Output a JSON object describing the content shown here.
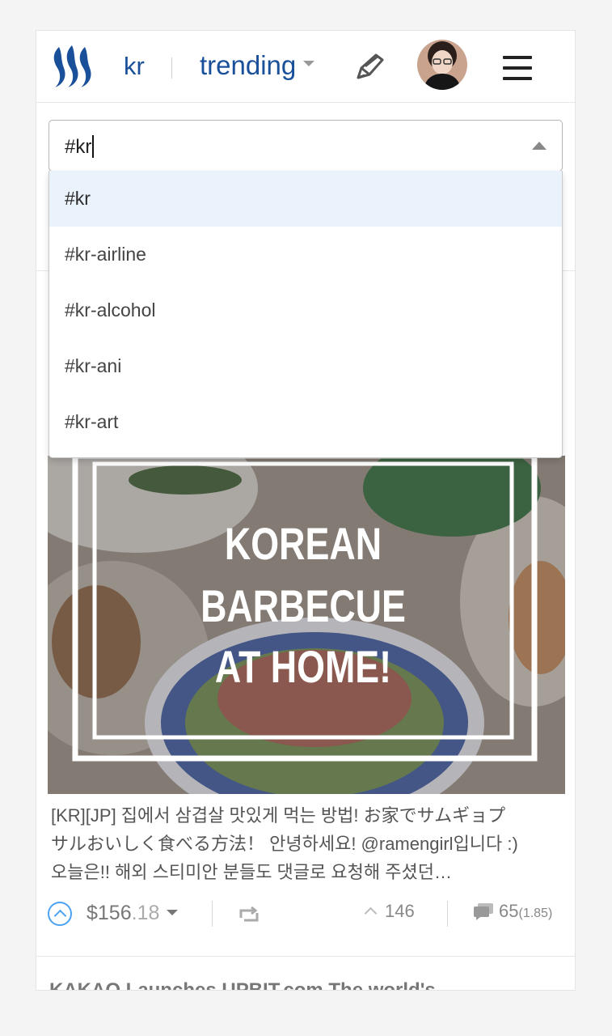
{
  "header": {
    "tag": "kr",
    "sort": "trending"
  },
  "search": {
    "value": "#kr",
    "options": [
      "#kr",
      "#kr-airline",
      "#kr-alcohol",
      "#kr-ani",
      "#kr-art"
    ]
  },
  "post": {
    "image_text": [
      "KOREAN",
      "BARBECUE",
      "AT HOME!"
    ],
    "excerpt_lines": [
      "[KR][JP] 집에서 삼겹살 맛있게 먹는 방법! お家でサムギョプ",
      "サルおいしく食べる方法！ 안녕하세요! @ramengirl입니다 :)",
      "오늘은!! 해외 스티미안 분들도 댓글로 요청해 주셨던…"
    ],
    "payout_main": "$156",
    "payout_cents": ".18",
    "votes": "146",
    "comments": "65",
    "comments_extra": "(1.85)"
  },
  "next_post": {
    "title": "KAKAO Launches UPBIT.com The world's"
  },
  "colors": {
    "link": "#1a5099",
    "upvote": "#4ba2f2",
    "active_option": "#eaf2fb"
  }
}
